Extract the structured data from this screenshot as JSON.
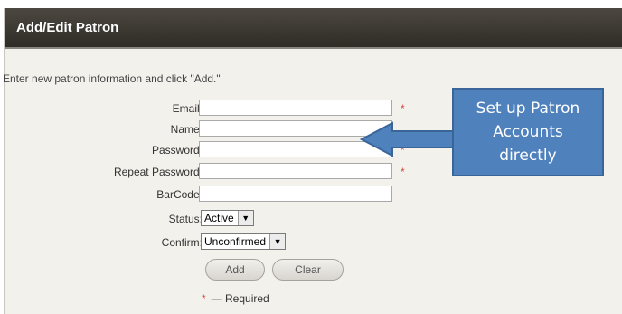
{
  "header": {
    "title": "Add/Edit Patron"
  },
  "intro": "Enter new patron information and click \"Add.\"",
  "fields": [
    {
      "label": "Email:",
      "value": "",
      "required": true
    },
    {
      "label": "Name:",
      "value": "",
      "required": false
    },
    {
      "label": "Password:",
      "value": "",
      "required": true
    },
    {
      "label": "Repeat Password:",
      "value": "",
      "required": true
    },
    {
      "label": "BarCode:",
      "value": "",
      "required": false
    }
  ],
  "status": {
    "label": "Status:",
    "value": "Active"
  },
  "confirm": {
    "label": "Confirm:",
    "value": "Unconfirmed"
  },
  "buttons": {
    "add": "Add",
    "clear": "Clear"
  },
  "required_note": {
    "star": "*",
    "text": "— Required"
  },
  "required_marker": "*",
  "callout": {
    "text_lines": [
      "Set up Patron",
      "Accounts",
      "directly"
    ]
  },
  "colors": {
    "header_bg": "#3a3630",
    "panel_bg": "#f3f1ec",
    "callout_bg": "#4f81bd",
    "required": "#d24b3c"
  }
}
